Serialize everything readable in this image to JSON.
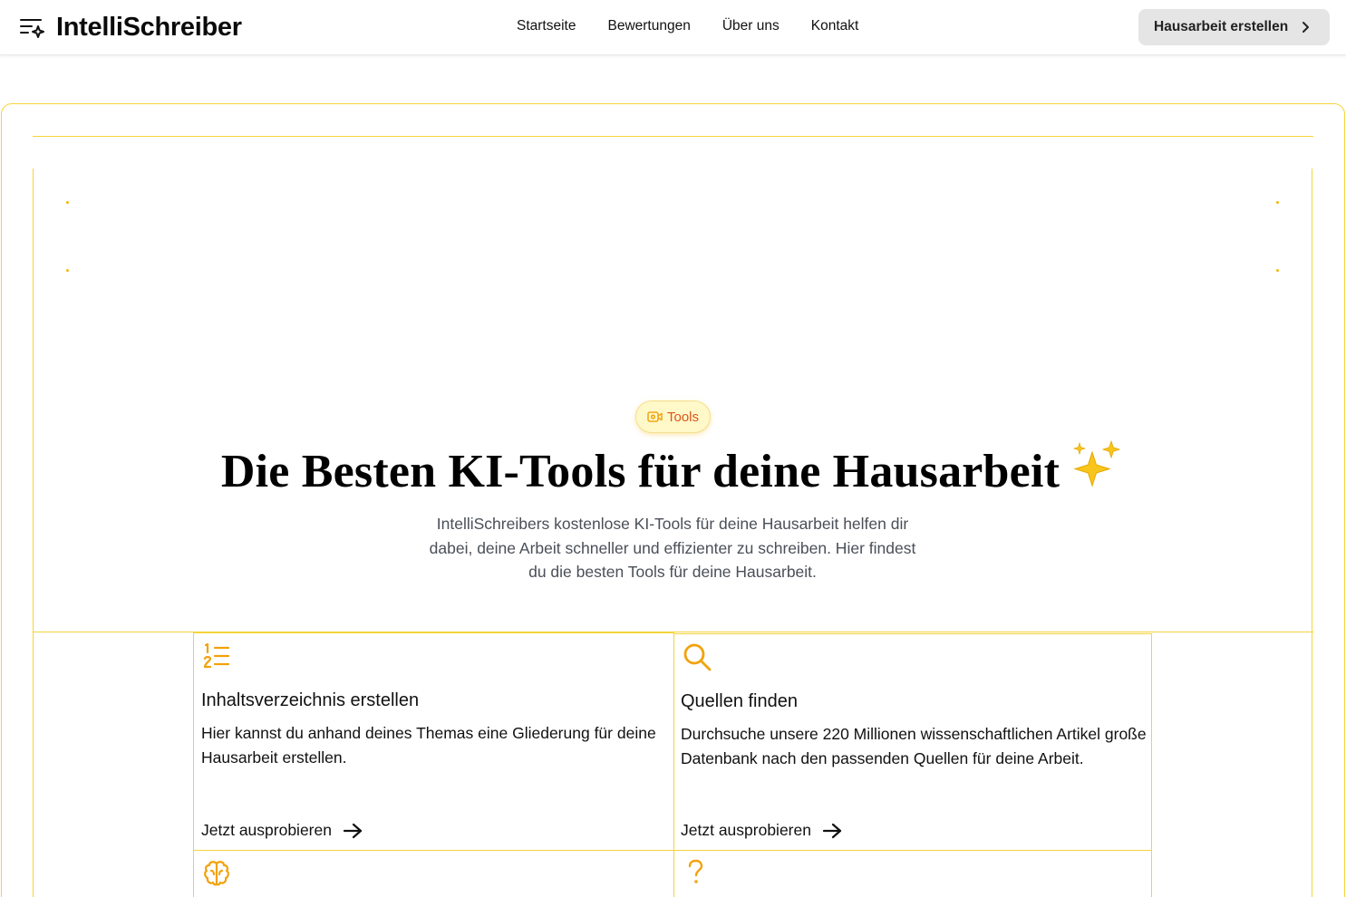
{
  "brand": {
    "name": "IntelliSchreiber",
    "accent": "#f5d43a",
    "icon_accent": "#f2a20c",
    "badge_text_color": "#d9561b"
  },
  "nav": {
    "links": [
      "Startseite",
      "Bewertungen",
      "Über uns",
      "Kontakt"
    ],
    "cta_label": "Hausarbeit erstellen"
  },
  "hero": {
    "badge": "Tools",
    "title": "Die Besten KI-Tools für deine Hausarbeit",
    "title_emoji": "sparkles-icon",
    "subtitle": "IntelliSchreibers kostenlose KI-Tools für deine Hausarbeit helfen dir dabei, deine Arbeit schneller und effizienter zu schreiben. Hier findest du die besten Tools für deine Hausarbeit."
  },
  "cards": [
    {
      "icon": "numbered-list-icon",
      "title": "Inhaltsverzeichnis erstellen",
      "desc": "Hier kannst du anhand deines Themas eine Gliederung für deine Hausarbeit erstellen.",
      "link": "Jetzt ausprobieren"
    },
    {
      "icon": "search-icon",
      "title": "Quellen finden",
      "desc": "Durchsuche unsere 220 Millionen wissenschaftlichen Artikel große Datenbank nach den passenden Quellen für deine Arbeit.",
      "link": "Jetzt ausprobieren"
    },
    {
      "icon": "brain-icon"
    },
    {
      "icon": "question-mark-icon"
    }
  ]
}
